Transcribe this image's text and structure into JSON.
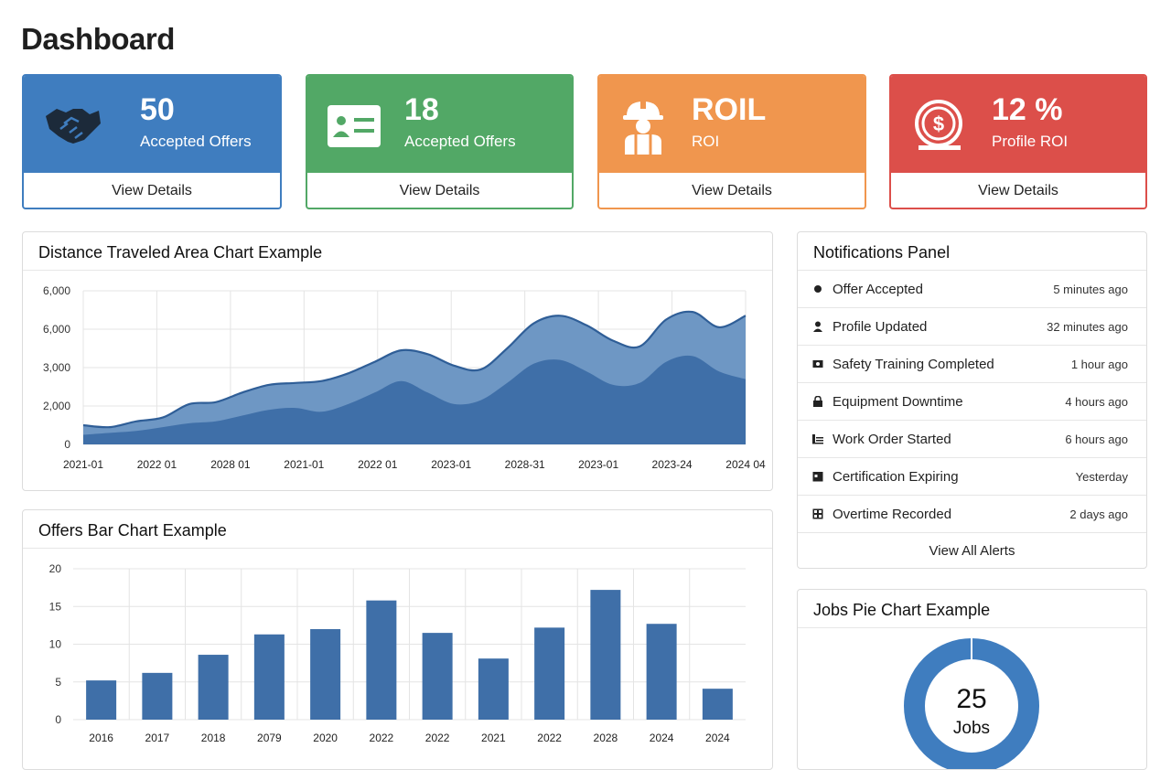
{
  "page": {
    "title": "Dashboard"
  },
  "cards": [
    {
      "value": "50",
      "label": "Accepted Offers",
      "link": "View Details",
      "icon": "handshake-icon",
      "color": "#3f7dbf",
      "border": "#3f7dbf"
    },
    {
      "value": "18",
      "label": "Accepted Offers",
      "link": "View Details",
      "icon": "id-card-icon",
      "color": "#52a866",
      "border": "#52a866"
    },
    {
      "value": "ROIL",
      "label": "ROI",
      "link": "View Details",
      "icon": "hard-hat-worker-icon",
      "color": "#f0964e",
      "border": "#f0964e"
    },
    {
      "value": "12 %",
      "label": "Profile ROI",
      "link": "View Details",
      "icon": "dollar-coin-icon",
      "color": "#dc4f4a",
      "border": "#dc4f4a"
    }
  ],
  "area_panel": {
    "title": "Distance Traveled Area Chart Example"
  },
  "bar_panel": {
    "title": "Offers Bar Chart Example"
  },
  "notifications": {
    "title": "Notifications Panel",
    "items": [
      {
        "text": "Offer Accepted",
        "time": "5 minutes ago",
        "icon": "dot-icon"
      },
      {
        "text": "Profile Updated",
        "time": "32 minutes ago",
        "icon": "user-icon"
      },
      {
        "text": "Safety Training Completed",
        "time": "1 hour ago",
        "icon": "certificate-icon"
      },
      {
        "text": "Equipment Downtime",
        "time": "4 hours ago",
        "icon": "lock-icon"
      },
      {
        "text": "Work Order Started",
        "time": "6 hours ago",
        "icon": "list-icon"
      },
      {
        "text": "Certification Expiring",
        "time": "Yesterday",
        "icon": "calendar-icon"
      },
      {
        "text": "Overtime Recorded",
        "time": "2 days ago",
        "icon": "grid-icon"
      }
    ],
    "view_all": "View All Alerts"
  },
  "pie_panel": {
    "title": "Jobs Pie Chart Example"
  },
  "chart_data": [
    {
      "type": "area",
      "title": "Distance Traveled Area Chart Example",
      "y_tick_labels": [
        "6,000",
        "6,000",
        "3,000",
        "2,000",
        "0"
      ],
      "y_tick_values": [
        8000,
        6000,
        4000,
        2000,
        0
      ],
      "x_tick_labels": [
        "2021-01",
        "2022 01",
        "2028 01",
        "2021-01",
        "2022 01",
        "2023-01",
        "2028-31",
        "2023-01",
        "2023-24",
        "2024 04"
      ],
      "grid": true,
      "series": [
        {
          "values": [
            1000,
            900,
            1200,
            1400,
            2100,
            2200,
            2700,
            3100,
            3200,
            3300,
            3700,
            4300,
            4900,
            4700,
            4100,
            3900,
            5000,
            6300,
            6700,
            6200,
            5400,
            5100,
            6500,
            6900,
            6100,
            6700
          ]
        },
        {
          "values": [
            500,
            600,
            700,
            900,
            1100,
            1200,
            1500,
            1800,
            1900,
            1700,
            2100,
            2700,
            3300,
            2700,
            2100,
            2300,
            3200,
            4200,
            4400,
            3800,
            3100,
            3200,
            4300,
            4600,
            3800,
            3400
          ]
        }
      ],
      "colors": {
        "upper": "#6e97c4",
        "lower": "#3f6fa8",
        "line": "#2f5e97"
      }
    },
    {
      "type": "bar",
      "title": "Offers Bar Chart Example",
      "categories": [
        "2016",
        "2017",
        "2018",
        "2079",
        "2020",
        "2022",
        "2022",
        "2021",
        "2022",
        "2028",
        "2024",
        "2024"
      ],
      "values": [
        5.2,
        6.2,
        8.6,
        11.3,
        12,
        15.8,
        11.5,
        8.1,
        12.2,
        17.2,
        12.7,
        4.1
      ],
      "ylim": [
        0,
        20
      ],
      "y_ticks": [
        0,
        5,
        10,
        15,
        20
      ],
      "grid": true,
      "color": "#3f6fa8"
    },
    {
      "type": "pie",
      "title": "Jobs Pie Chart Example",
      "slices": [
        {
          "value": 25
        }
      ],
      "center_value": "25",
      "center_label": "Jobs",
      "color": "#3f7dbf"
    }
  ]
}
